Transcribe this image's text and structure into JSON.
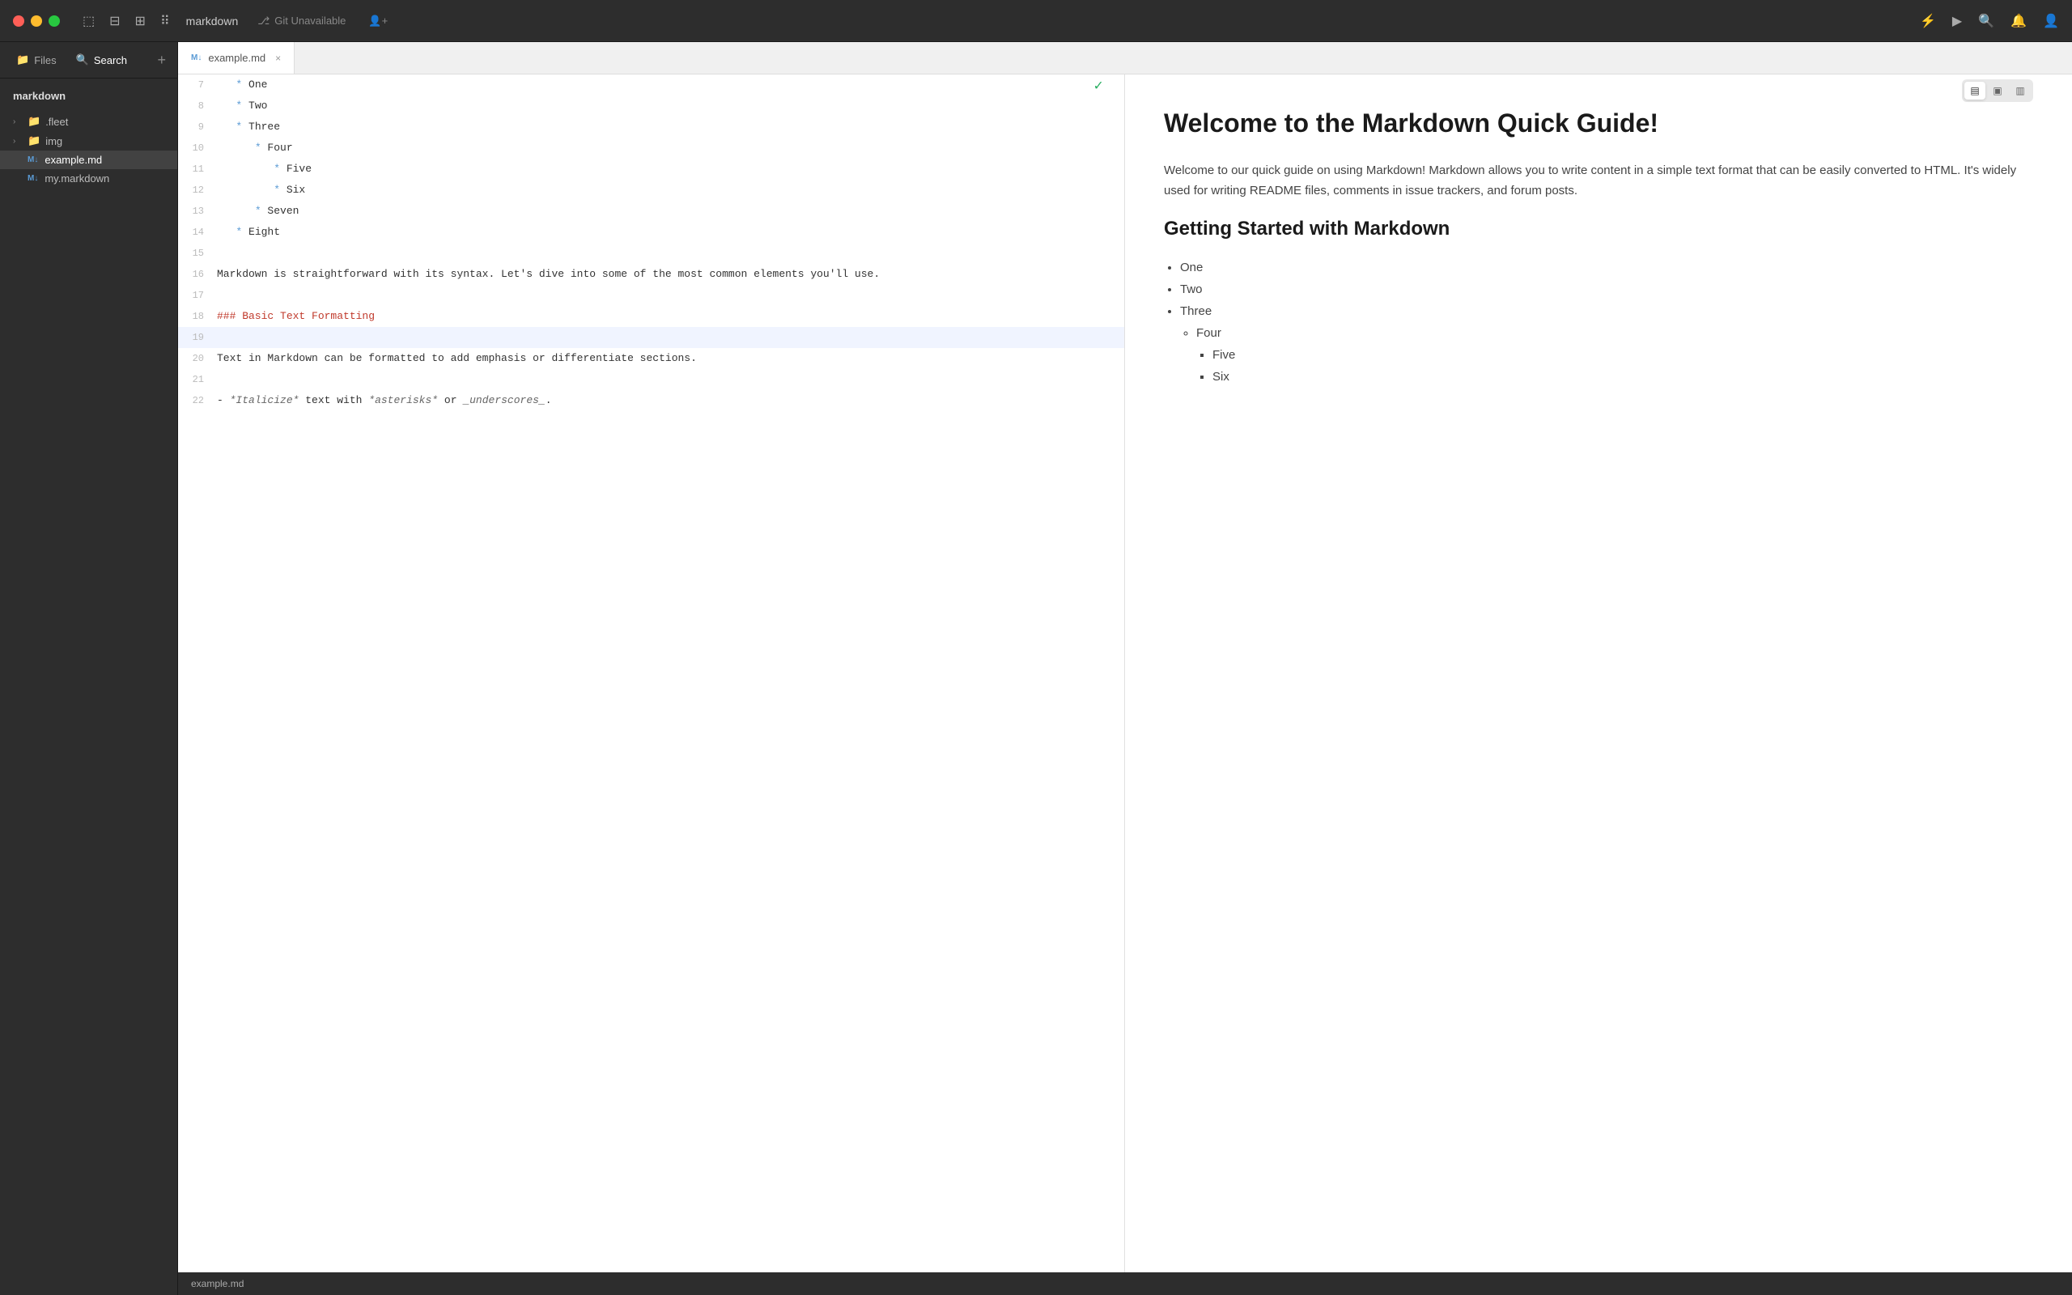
{
  "titlebar": {
    "title": "markdown",
    "git_status": "Git Unavailable",
    "add_icon": "➕"
  },
  "sidebar": {
    "project_title": "markdown",
    "files_tab": "Files",
    "search_tab": "Search",
    "tree_items": [
      {
        "id": "fleet",
        "label": ".fleet",
        "type": "folder",
        "depth": 0
      },
      {
        "id": "img",
        "label": "img",
        "type": "folder",
        "depth": 0
      },
      {
        "id": "example-md",
        "label": "example.md",
        "type": "md-file",
        "depth": 0,
        "active": true
      },
      {
        "id": "my-markdown",
        "label": "my.markdown",
        "type": "md-file",
        "depth": 0
      }
    ]
  },
  "tab": {
    "label": "example.md"
  },
  "editor": {
    "lines": [
      {
        "num": 7,
        "content": "   * One",
        "type": "list-item",
        "indent": 0
      },
      {
        "num": 8,
        "content": "   * Two",
        "type": "list-item",
        "indent": 0
      },
      {
        "num": 9,
        "content": "   * Three",
        "type": "list-item",
        "indent": 0
      },
      {
        "num": 10,
        "content": "      * Four",
        "type": "list-item",
        "indent": 1
      },
      {
        "num": 11,
        "content": "         * Five",
        "type": "list-item",
        "indent": 2
      },
      {
        "num": 12,
        "content": "         * Six",
        "type": "list-item",
        "indent": 2
      },
      {
        "num": 13,
        "content": "      * Seven",
        "type": "list-item",
        "indent": 1
      },
      {
        "num": 14,
        "content": "   * Eight",
        "type": "list-item",
        "indent": 0
      },
      {
        "num": 15,
        "content": "",
        "type": "empty"
      },
      {
        "num": 16,
        "content": "Markdown is straightforward with its syntax. Let's dive into some of the most common elements you'll use.",
        "type": "text"
      },
      {
        "num": 17,
        "content": "",
        "type": "empty"
      },
      {
        "num": 18,
        "content": "### Basic Text Formatting",
        "type": "heading"
      },
      {
        "num": 19,
        "content": "",
        "type": "empty",
        "highlighted": true
      },
      {
        "num": 20,
        "content": "Text in Markdown can be formatted to add emphasis or differentiate sections.",
        "type": "text"
      },
      {
        "num": 21,
        "content": "",
        "type": "empty"
      },
      {
        "num": 22,
        "content": "- *Italicize* text with *asterisks* or _underscores_.",
        "type": "italic-example"
      }
    ]
  },
  "preview": {
    "h1": "Welcome to the Markdown Quick Guide!",
    "intro_p": "Welcome to our quick guide on using Markdown! Markdown allows you to write content in a simple text format that can be easily converted to HTML. It's widely used for writing README files, comments in issue trackers, and forum posts.",
    "h2": "Getting Started with Markdown",
    "list": [
      {
        "label": "One",
        "children": []
      },
      {
        "label": "Two",
        "children": []
      },
      {
        "label": "Three",
        "children": [
          {
            "label": "Four",
            "children": [
              {
                "label": "Five",
                "children": []
              },
              {
                "label": "Six",
                "children": []
              }
            ]
          }
        ]
      }
    ]
  },
  "status_bar": {
    "filename": "example.md"
  },
  "view_toggle": {
    "btn1_icon": "▤",
    "btn2_icon": "▣",
    "btn3_icon": "▥"
  },
  "colors": {
    "accent_blue": "#5b9bd5",
    "heading_red": "#c0392b",
    "active_bg": "#f0f4ff"
  }
}
